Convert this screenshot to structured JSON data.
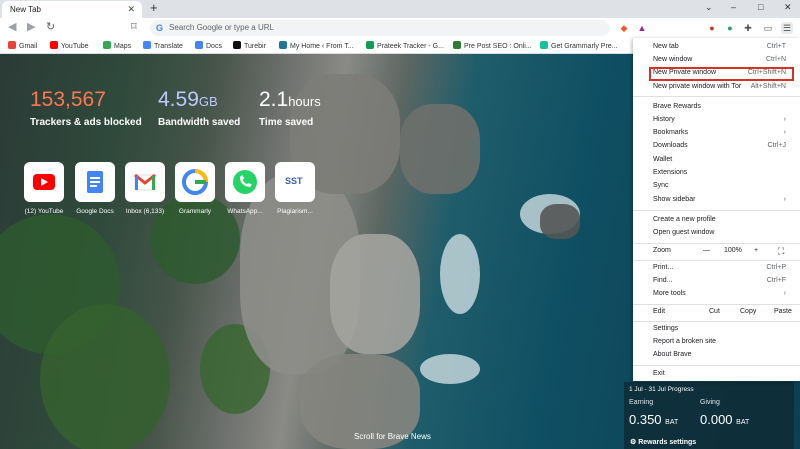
{
  "tab": {
    "title": "New Tab"
  },
  "window_controls": {
    "minimize": "–",
    "maximize": "□",
    "close": "✕",
    "tab_search": "⌄"
  },
  "omnibox": {
    "placeholder": "Search Google or type a URL"
  },
  "bookmarks": [
    {
      "label": "Gmail",
      "color": "#ea4335"
    },
    {
      "label": "YouTube",
      "color": "#ff0000"
    },
    {
      "label": "Maps",
      "color": "#34a853"
    },
    {
      "label": "Translate",
      "color": "#4285f4"
    },
    {
      "label": "Docs",
      "color": "#4285f4"
    },
    {
      "label": "Turebir",
      "color": "#111111"
    },
    {
      "label": "My Home ‹ From T...",
      "color": "#21759b"
    },
    {
      "label": "Prateek Tracker - G...",
      "color": "#0f9d58"
    },
    {
      "label": "Pre Post SEO : Onli...",
      "color": "#2e7d32"
    },
    {
      "label": "Get Grammarly Pre...",
      "color": "#15c39a"
    }
  ],
  "stats": [
    {
      "value": "153,567",
      "unit": "",
      "label": "Trackers & ads blocked",
      "color": "#ff7652"
    },
    {
      "value": "4.59",
      "unit": "GB",
      "label": "Bandwidth saved",
      "color": "#bfc7ff"
    },
    {
      "value": "2.1",
      "unit": "hours",
      "label": "Time saved",
      "color": "#ffffff"
    }
  ],
  "top_sites": [
    {
      "label": "(12) YouTube",
      "icon": "youtube-icon"
    },
    {
      "label": "Google Docs",
      "icon": "docs-icon"
    },
    {
      "label": "Inbox (6,133)",
      "icon": "gmail-icon"
    },
    {
      "label": "Grammarly",
      "icon": "grammarly-icon"
    },
    {
      "label": "WhatsApp...",
      "icon": "whatsapp-icon"
    },
    {
      "label": "Plagiarism...",
      "icon": "sst-icon",
      "text": "SST"
    }
  ],
  "scroll_news": "Scroll for Brave News",
  "rewards": {
    "period": "1 Jul - 31 Jul Progress",
    "earning_label": "Earning",
    "earning_value": "0.350",
    "giving_label": "Giving",
    "giving_value": "0.000",
    "unit": "BAT",
    "settings_label": "Rewards settings"
  },
  "menu": {
    "items": [
      {
        "label": "New tab",
        "shortcut": "Ctrl+T"
      },
      {
        "label": "New window",
        "shortcut": "Ctrl+N"
      },
      {
        "label": "New Private window",
        "shortcut": "Ctrl+Shift+N",
        "highlighted": true
      },
      {
        "label": "New private window with Tor",
        "shortcut": "Alt+Shift+N"
      },
      {
        "label": "Brave Rewards",
        "shortcut": ""
      },
      {
        "label": "History",
        "shortcut": ""
      },
      {
        "label": "Bookmarks",
        "shortcut": ""
      },
      {
        "label": "Downloads",
        "shortcut": "Ctrl+J"
      },
      {
        "label": "Wallet",
        "shortcut": ""
      },
      {
        "label": "Extensions",
        "shortcut": ""
      },
      {
        "label": "Sync",
        "shortcut": ""
      },
      {
        "label": "Show sidebar",
        "shortcut": ""
      },
      {
        "label": "Create a new profile",
        "shortcut": ""
      },
      {
        "label": "Open guest window",
        "shortcut": ""
      },
      {
        "label": "Print...",
        "shortcut": "Ctrl+P"
      },
      {
        "label": "Find...",
        "shortcut": "Ctrl+F"
      },
      {
        "label": "More tools",
        "shortcut": ""
      },
      {
        "label": "Settings",
        "shortcut": ""
      },
      {
        "label": "Report a broken site",
        "shortcut": ""
      },
      {
        "label": "About Brave",
        "shortcut": ""
      },
      {
        "label": "Exit",
        "shortcut": ""
      }
    ],
    "zoom": {
      "label": "Zoom",
      "minus": "—",
      "value": "100%",
      "plus": "+"
    },
    "edit": {
      "label": "Edit",
      "cut": "Cut",
      "copy": "Copy",
      "paste": "Paste"
    },
    "submenu_arrow": "›"
  }
}
